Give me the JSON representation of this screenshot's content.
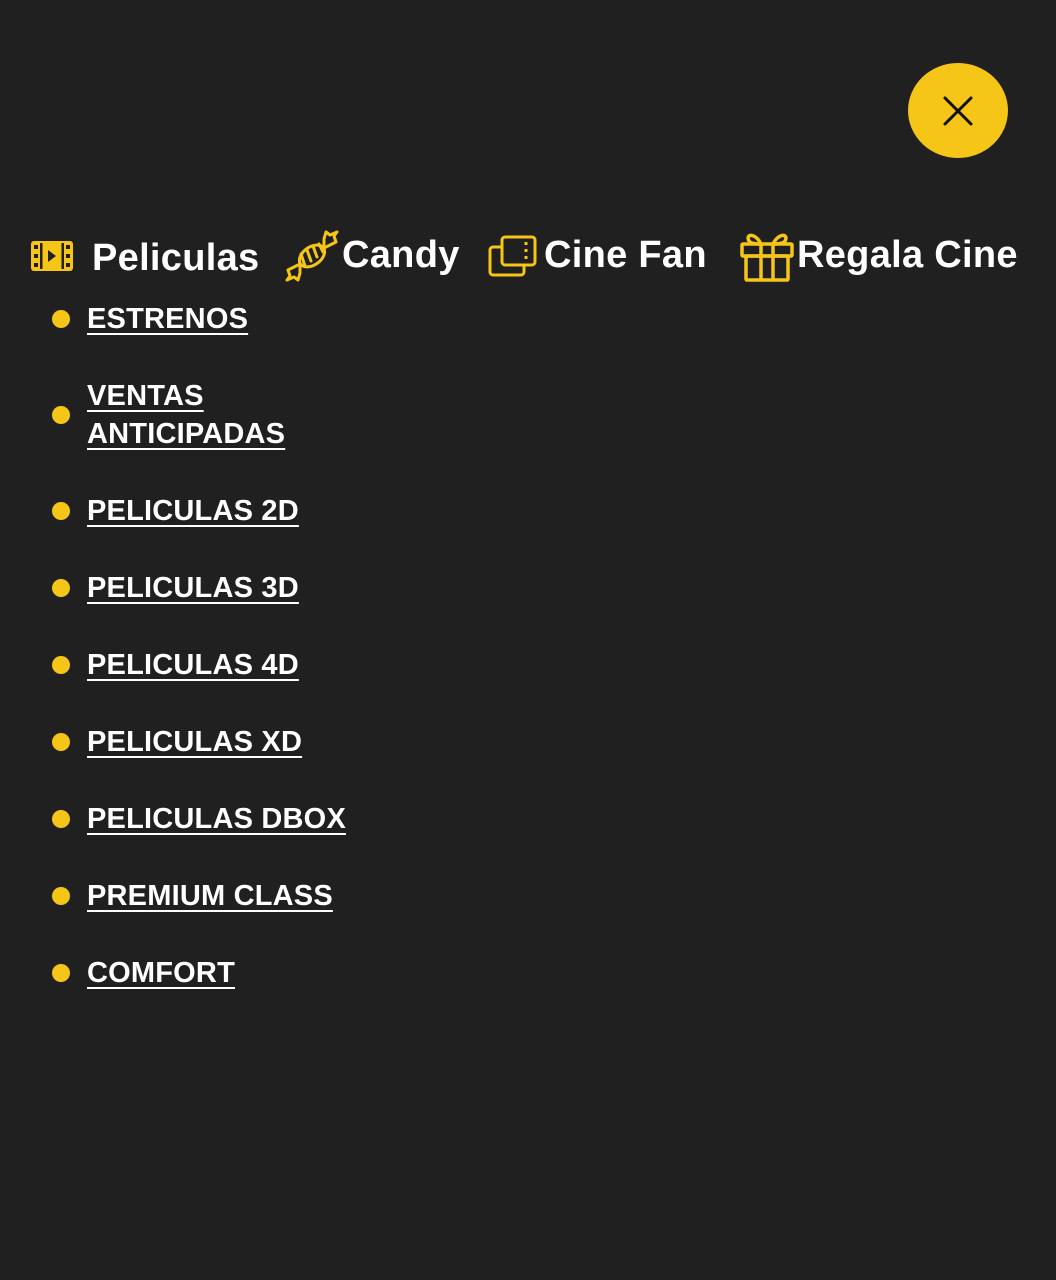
{
  "close": {
    "icon": "close-icon"
  },
  "colors": {
    "accent": "#f5c518",
    "background": "#202020",
    "text": "#ffffff"
  },
  "tabs": [
    {
      "label": "Peliculas",
      "icon": "film-icon"
    },
    {
      "label": "Candy",
      "icon": "candy-icon"
    },
    {
      "label": "Cine Fan",
      "icon": "cards-icon"
    },
    {
      "label": "Regala Cine",
      "icon": "gift-icon"
    }
  ],
  "submenu": {
    "items": [
      {
        "label": "ESTRENOS"
      },
      {
        "label": "VENTAS ANTICIPADAS"
      },
      {
        "label": "PELICULAS 2D"
      },
      {
        "label": "PELICULAS 3D"
      },
      {
        "label": "PELICULAS 4D"
      },
      {
        "label": "PELICULAS XD"
      },
      {
        "label": "PELICULAS DBOX"
      },
      {
        "label": "PREMIUM CLASS"
      },
      {
        "label": "COMFORT"
      }
    ]
  }
}
